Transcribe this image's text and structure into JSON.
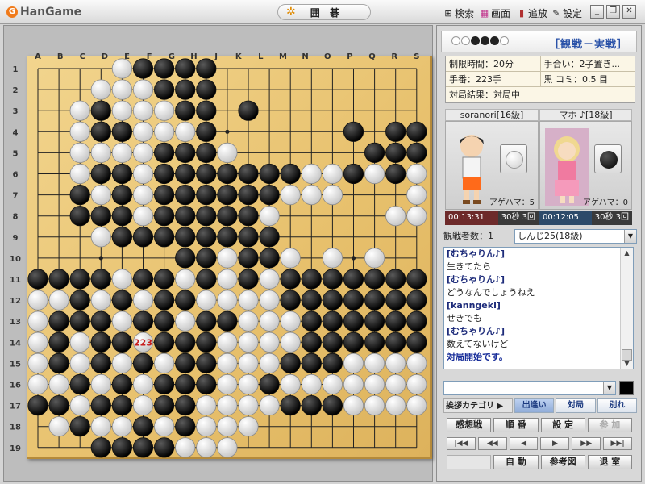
{
  "titlebar": {
    "logo": "HanGame",
    "game_name": "囲 碁",
    "menu": [
      {
        "icon": "binoculars-icon",
        "label": "検索"
      },
      {
        "icon": "screen-icon",
        "label": "画面"
      },
      {
        "icon": "add-friend-icon",
        "label": "追放"
      },
      {
        "icon": "settings-icon",
        "label": "設定"
      }
    ]
  },
  "board": {
    "columns": [
      "A",
      "B",
      "C",
      "D",
      "E",
      "F",
      "G",
      "H",
      "J",
      "K",
      "L",
      "M",
      "N",
      "O",
      "P",
      "Q",
      "R",
      "S"
    ],
    "rows": [
      "1",
      "2",
      "3",
      "4",
      "5",
      "6",
      "7",
      "8",
      "9",
      "10",
      "11",
      "12",
      "13",
      "14",
      "15",
      "16",
      "17",
      "18",
      "19"
    ],
    "grid_size": 19,
    "last_move_label": "223",
    "stones": [
      "....WBBBB..........",
      "...WWWBBB..........",
      "..WBWWWBB.B........",
      "..WBBWWWB......B.BB",
      "..WWWWBBBW......BBB",
      "..WBBWBBBBBBBWWBWBW",
      "..BWBWBBBBBBWWW...W",
      "..BBBWBBBBBW.....WW",
      "...WBBBBBBBB.......",
      ".......BBWBBW.W.W..",
      "BBBBWBBWBWBWBBBBBBB",
      "WWBWBWBBWWWWBBBBBBB",
      "WBBBWBBWBBWWWBBBBBB",
      "WBWBBWBBBWWWWBBBBBB",
      "WBWBWBWBBWWWBBBWWWW",
      "WWBWBWBBBWWBWWWWWWW",
      "BBWBBWBBWWWWBBBWWWW",
      ".WBWWBWBWWW........",
      "...BBBBWWW........."
    ]
  },
  "panel": {
    "title": "［観戦－実戦］",
    "info": [
      [
        "制限時間：20分",
        "手合い：2子置き..."
      ],
      [
        "手番：223手",
        "黒 コミ：0.5 目"
      ],
      [
        "対局結果：対局中",
        ""
      ]
    ],
    "players": [
      {
        "name": "soranori[16級]",
        "stone_color": "#ffffff",
        "agehama": "アゲハマ：5",
        "clock": "00:13:31",
        "byoyomi": "30秒 3回",
        "clock_bg": "#6d2a2a"
      },
      {
        "name": "マホ ♪[18級]",
        "stone_color": "#111111",
        "agehama": "アゲハマ：0",
        "clock": "00:12:05",
        "byoyomi": "30秒 3回",
        "clock_bg": "#2c4a6a"
      }
    ],
    "watchers_label": "観戦者数：1",
    "watchers_selected": "しんじ25(18級)",
    "chat": [
      {
        "type": "speaker",
        "text": "[むちゃりん♪]"
      },
      {
        "type": "msg",
        "text": "生きてたら"
      },
      {
        "type": "speaker",
        "text": "[むちゃりん♪]"
      },
      {
        "type": "msg",
        "text": "どうなんでしょうねえ"
      },
      {
        "type": "speaker",
        "text": "[kanngeki]"
      },
      {
        "type": "msg",
        "text": "せきでも"
      },
      {
        "type": "speaker",
        "text": "[むちゃりん♪]"
      },
      {
        "type": "msg",
        "text": "数えてないけど"
      },
      {
        "type": "sys",
        "text": "対局開始です。"
      }
    ],
    "greet_label": "挨拶カテゴリ ▶",
    "greet_buttons": [
      "出逢い",
      "対局",
      "別れ"
    ],
    "buttons_row1": [
      "感想戦",
      "順 番",
      "設 定",
      "参 加"
    ],
    "nav_buttons": [
      "|◀◀",
      "◀◀",
      "◀",
      "▶",
      "▶▶",
      "▶▶|"
    ],
    "buttons_row3": [
      "自 動",
      "参考図",
      "退 室"
    ]
  }
}
